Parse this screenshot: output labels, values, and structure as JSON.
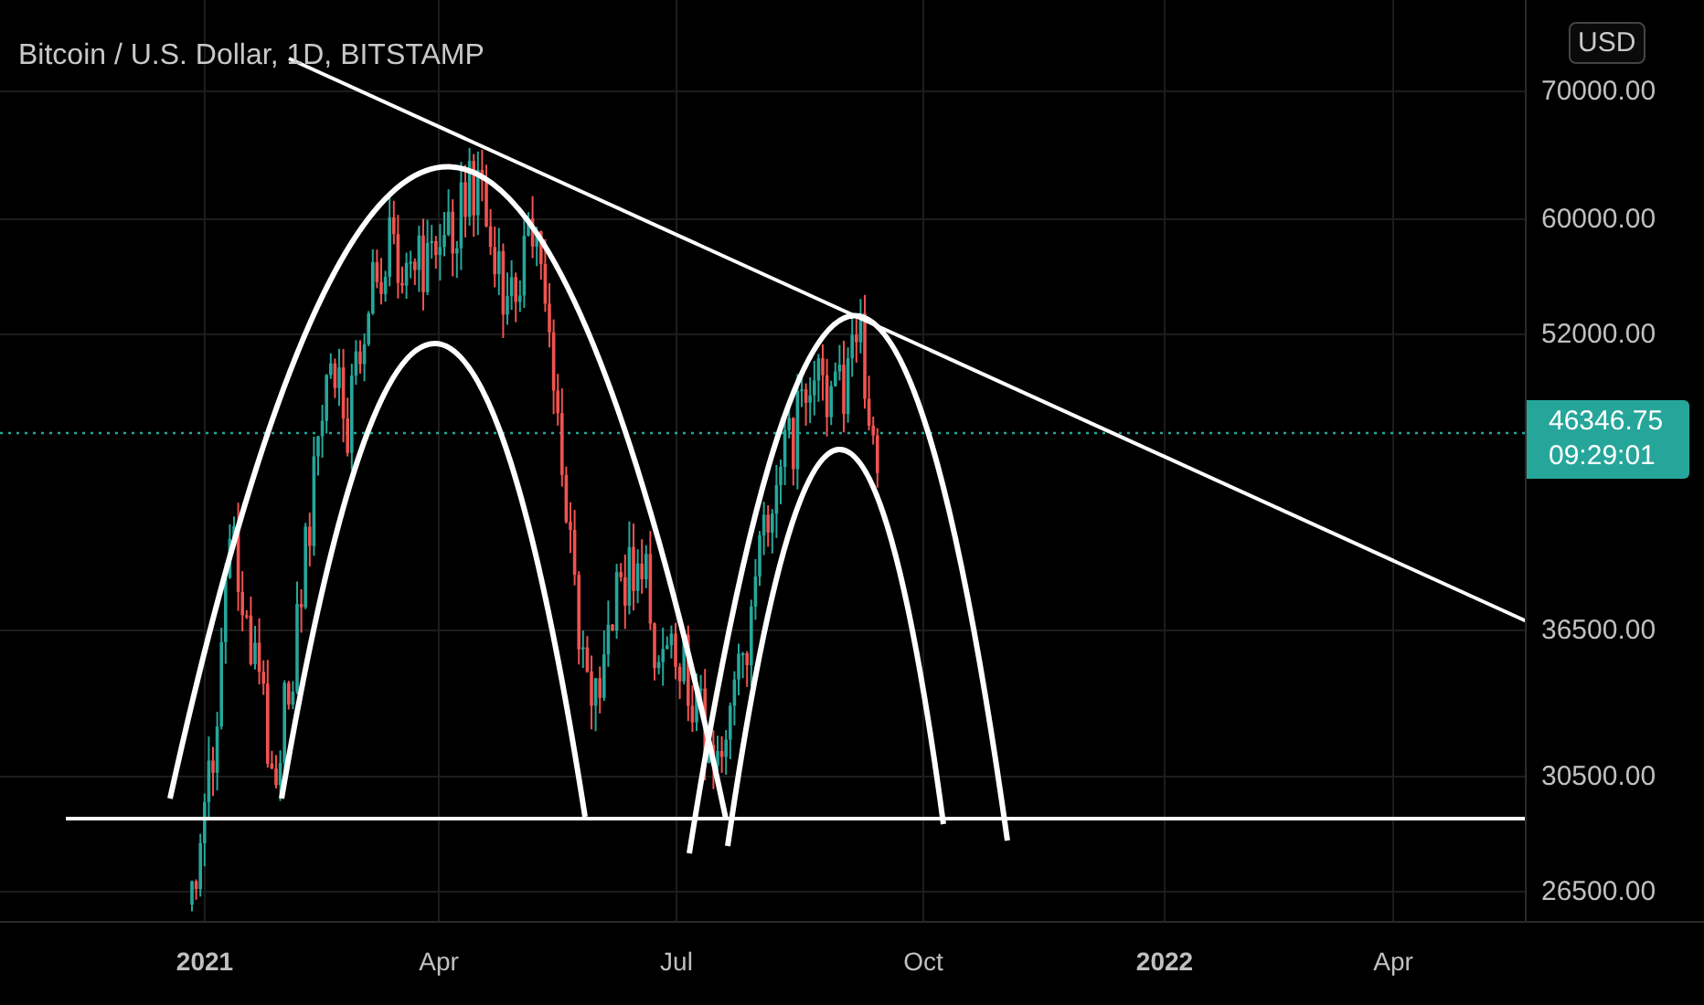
{
  "title": "Bitcoin / U.S. Dollar, 1D, BITSTAMP",
  "currency_button": "USD",
  "price_axis": [
    "70000.00",
    "60000.00",
    "52000.00",
    "36500.00",
    "30500.00",
    "26500.00"
  ],
  "last_price": {
    "price": "46346.75",
    "countdown": "09:29:01"
  },
  "time_axis": [
    {
      "label": "2021",
      "kind": "year"
    },
    {
      "label": "Apr",
      "kind": "month"
    },
    {
      "label": "Jul",
      "kind": "month"
    },
    {
      "label": "Oct",
      "kind": "month"
    },
    {
      "label": "2022",
      "kind": "year"
    },
    {
      "label": "Apr",
      "kind": "month"
    }
  ]
}
